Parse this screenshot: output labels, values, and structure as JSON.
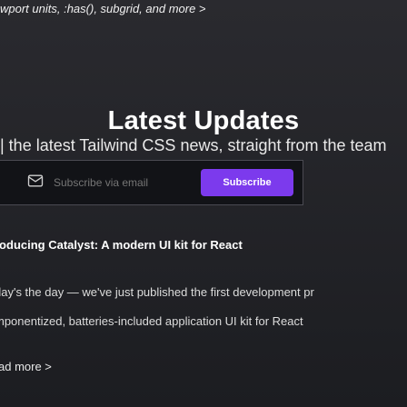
{
  "topline": "wport units, :has(), subgrid, and more  >",
  "section": {
    "heading": "Latest Updates",
    "subheading": "| the latest Tailwind CSS news, straight from the team"
  },
  "subscribe": {
    "icon": "mail-icon",
    "placeholder": "Subscribe via email",
    "button_label": "Subscribe",
    "accent_color": "#7c3aed"
  },
  "article": {
    "title": "roducing Catalyst: A modern UI kit for React",
    "line1": "day's the day — we've just published the first development pr",
    "line2": "mponentized, batteries-included application UI kit for React",
    "read_more": "ad more  >"
  }
}
